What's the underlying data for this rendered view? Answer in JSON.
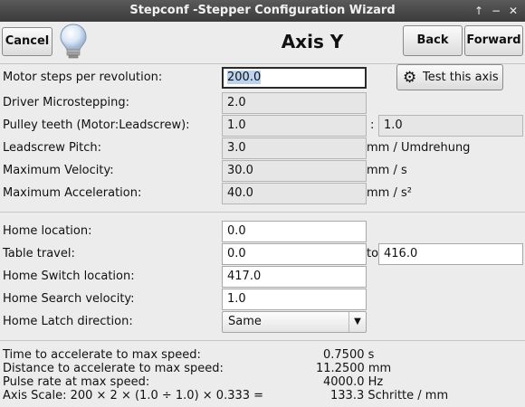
{
  "window": {
    "title": "Stepconf -Stepper Configuration Wizard"
  },
  "header": {
    "cancel_label": "Cancel",
    "title": "Axis Y",
    "back_label": "Back",
    "forward_label": "Forward"
  },
  "motor": {
    "steps_label": "Motor steps per revolution:",
    "steps_value": "200.0",
    "test_label": "Test this axis",
    "microstep_label": "Driver Microstepping:",
    "microstep_value": "2.0",
    "pulley_label": "Pulley teeth (Motor:Leadscrew):",
    "pulley_motor": "1.0",
    "pulley_sep": ":",
    "pulley_leadscrew": "1.0",
    "pitch_label": "Leadscrew Pitch:",
    "pitch_value": "3.0",
    "pitch_unit": "mm / Umdrehung",
    "velocity_label": "Maximum Velocity:",
    "velocity_value": "30.0",
    "velocity_unit": "mm / s",
    "accel_label": "Maximum Acceleration:",
    "accel_value": "40.0",
    "accel_unit": "mm / s²"
  },
  "home": {
    "location_label": "Home location:",
    "location_value": "0.0",
    "travel_label": "Table travel:",
    "travel_min": "0.0",
    "travel_to": "to",
    "travel_max": "416.0",
    "switch_label": "Home Switch location:",
    "switch_value": "417.0",
    "search_label": "Home Search velocity:",
    "search_value": "1.0",
    "latch_label": "Home Latch direction:",
    "latch_value": "Same"
  },
  "stats": {
    "accel_time_label": "Time to accelerate to max speed:",
    "accel_time_value": "0.7500 s",
    "accel_dist_label": "Distance to accelerate to max speed:",
    "accel_dist_value": "11.2500 mm",
    "pulse_label": "Pulse rate at max speed:",
    "pulse_value": "4000.0 Hz",
    "scale_label": "Axis Scale: 200 × 2 × (1.0 ÷ 1.0) × 0.333 =",
    "scale_value": "133.3 Schritte / mm"
  }
}
